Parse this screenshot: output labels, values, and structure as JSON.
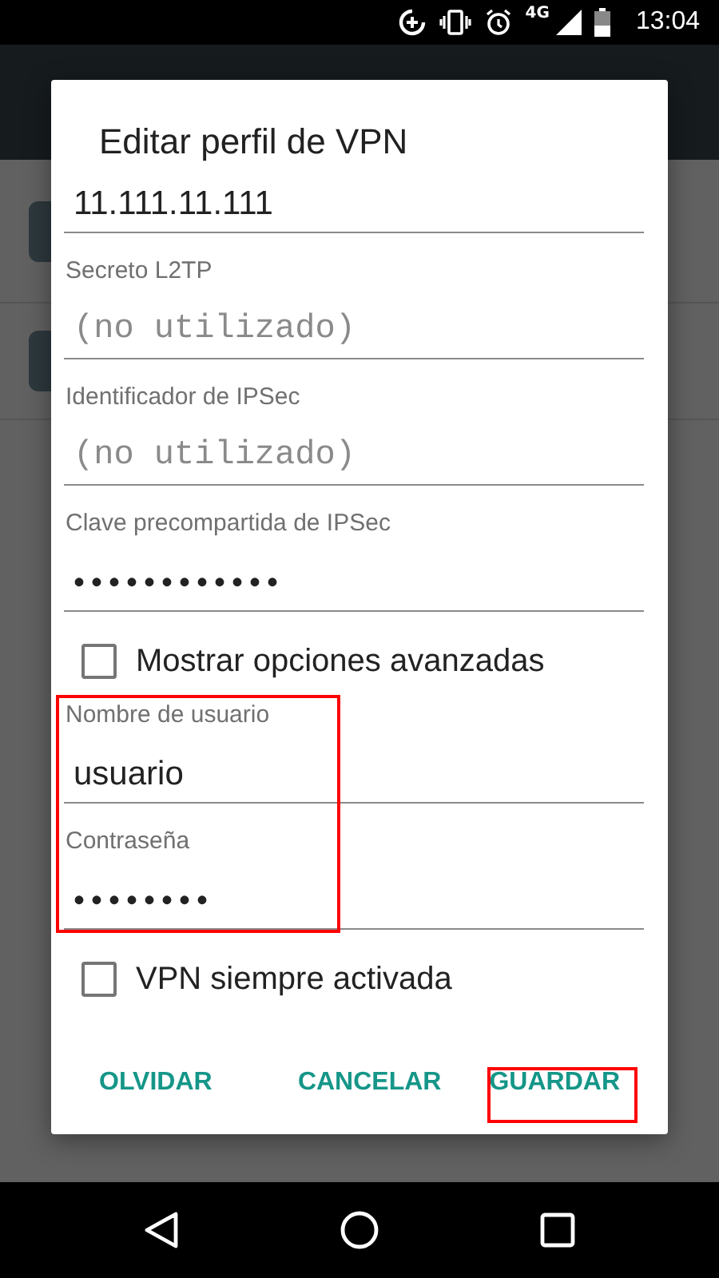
{
  "status_bar": {
    "network": "4G",
    "time": "13:04"
  },
  "dialog": {
    "title": "Editar perfil de VPN",
    "items": [
      {
        "kind": "field",
        "value": "11.111.11.111"
      },
      {
        "kind": "field",
        "label": "Secreto L2TP",
        "placeholder": "(no utilizado)"
      },
      {
        "kind": "field",
        "label": "Identificador de IPSec",
        "placeholder": "(no utilizado)"
      },
      {
        "kind": "field",
        "label": "Clave precompartida de IPSec",
        "value": "••••••••••••",
        "masked": true
      },
      {
        "kind": "checkbox",
        "label": "Mostrar opciones avanzadas",
        "checked": false
      },
      {
        "kind": "field",
        "label": "Nombre de usuario",
        "value": "usuario"
      },
      {
        "kind": "field",
        "label": "Contraseña",
        "value": "••••••••",
        "masked": true
      },
      {
        "kind": "checkbox",
        "label": "VPN siempre activada",
        "checked": false
      }
    ],
    "buttons": [
      "OLVIDAR",
      "CANCELAR",
      "GUARDAR"
    ]
  }
}
